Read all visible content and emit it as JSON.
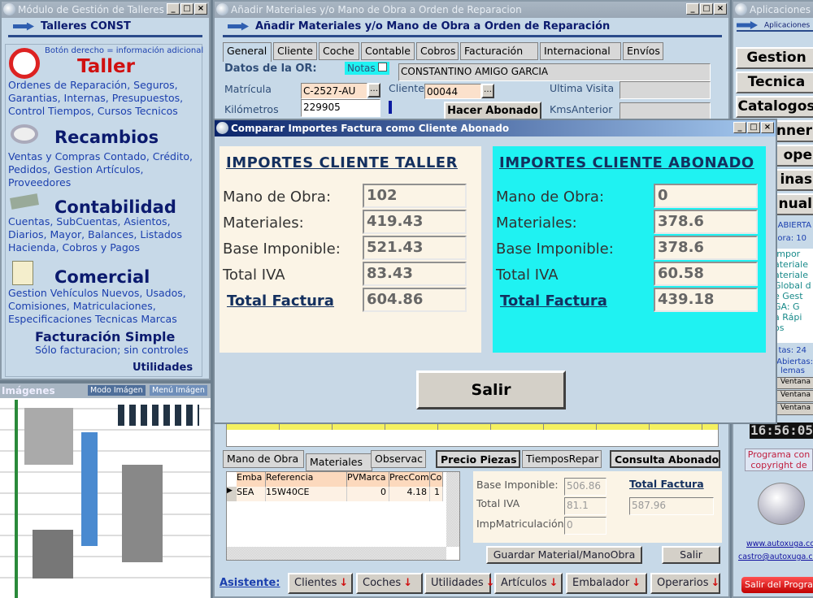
{
  "left_window": {
    "title": "Módulo de Gestión de Talleres",
    "header": "Talleres CONST",
    "hint": "Botón derecho = información adicional",
    "modules": [
      {
        "title": "Taller",
        "desc": "Ordenes de Reparación, Seguros, Garantias, Internas, Presupuestos, Control Tiempos, Cursos Tecnicos",
        "icon": "clock-icon"
      },
      {
        "title": "Recambios",
        "desc": "Ventas y Compras Contado, Crédito, Pedidos,  Gestion Artículos, Proveedores",
        "icon": "parts-icon"
      },
      {
        "title": "Contabilidad",
        "desc": "Cuentas, SubCuentas, Asientos, Diarios, Mayor, Balances, Listados Hacienda, Cobros y Pagos",
        "icon": "money-icon"
      },
      {
        "title": "Comercial",
        "desc": "Gestion Vehículos Nuevos, Usados, Comisiones, Matriculaciones, Especificaciones Tecnicas Marcas",
        "icon": "document-icon"
      }
    ],
    "simple_title": "Facturación Simple",
    "simple_desc": "Sólo facturacion; sin controles",
    "utilities": "Utilidades"
  },
  "images_panel": {
    "title": "Imágenes",
    "mode_button": "Modo Imágen",
    "menu_button": "Menú Imágen"
  },
  "main_window": {
    "title": "Añadir Materiales y/o Mano de Obra a Orden de Reparacion",
    "header": "Añadir Materiales y/o Mano de Obra a Orden de Reparación",
    "tabs": [
      "General",
      "Cliente",
      "Coche",
      "Contable",
      "Cobros",
      "Facturación",
      "Internacional",
      "Envíos"
    ],
    "datos_label": "Datos de la OR:",
    "notas_label": "Notas",
    "client_name": "CONSTANTINO AMIGO GARCIA",
    "matricula_label": "Matrícula",
    "matricula": "C-2527-AU",
    "cliente_label": "Cliente",
    "cliente": "00044",
    "ultima_visita_label": "Ultima Visita",
    "kms_label": "Kilómetros",
    "kms": "229905",
    "kms_anterior_label": "KmsAnterior",
    "hacer_abonado": "Hacer Abonado",
    "lower_tabs": [
      "Mano de Obra",
      "Materiales",
      "Observac",
      "Precio Piezas",
      "TiemposRepar",
      "Consulta Abonado"
    ],
    "grid_columns": [
      "Emba",
      "Referencia",
      "PVMarca",
      "PrecComp",
      "Co"
    ],
    "grid_rows": [
      [
        "SEA",
        "15W40CE",
        "0",
        "4.18",
        "1"
      ]
    ],
    "base_label": "Base Imponible:",
    "base": "506.86",
    "iva_label": "Total IVA",
    "iva": "81.1",
    "imp_label": "ImpMatriculación",
    "imp": "0",
    "total_label": "Total Factura",
    "total": "587.96",
    "save_button": "Guardar Material/ManoObra",
    "exit_button": "Salir",
    "assistant_label": "Asistente:",
    "assistant_buttons": [
      "Clientes",
      "Coches",
      "Utilidades",
      "Artículos",
      "Embalador",
      "Operarios"
    ]
  },
  "dialog": {
    "title": "Comparar Importes Factura como Cliente Abonado",
    "taller": {
      "heading": "IMPORTES CLIENTE TALLER",
      "rows": [
        {
          "label": "Mano de Obra:",
          "value": "102"
        },
        {
          "label": "Materiales:",
          "value": "419.43"
        },
        {
          "label": "Base Imponible:",
          "value": "521.43"
        },
        {
          "label": "Total IVA",
          "value": "83.43"
        },
        {
          "label": "Total Factura",
          "value": "604.86"
        }
      ]
    },
    "abonado": {
      "heading": "IMPORTES CLIENTE ABONADO",
      "rows": [
        {
          "label": "Mano de Obra:",
          "value": "0"
        },
        {
          "label": "Materiales:",
          "value": "378.6"
        },
        {
          "label": "Base Imponible:",
          "value": "378.6"
        },
        {
          "label": "Total IVA",
          "value": "60.58"
        },
        {
          "label": "Total Factura",
          "value": "439.18"
        }
      ]
    },
    "exit_button": "Salir"
  },
  "right_window": {
    "title": "Aplicaciones",
    "header": "Aplicaciones",
    "buttons": [
      "Gestion",
      "Tecnica",
      "Catalogos",
      "nner",
      "ope",
      "inas",
      "nual"
    ],
    "status1": "ABIERTA",
    "status2": "ora: 10",
    "list": [
      "Impor",
      "ateriale",
      "ateriale",
      "Global d",
      "e Gest",
      "GA:  G",
      "a Rápi",
      "os"
    ],
    "counts": "tas: 24",
    "open": "as Abiertas:",
    "problems": "lemas",
    "window_buttons": [
      "Ventana",
      "Ventana",
      "Ventana"
    ],
    "clock": "16:56:05",
    "copyright": "Programa con copyright de",
    "web": "www.autoxuga.com",
    "email": "castro@autoxuga.com",
    "exit": "Salir del Programa"
  },
  "colors": {
    "accent_cyan": "#1ff2f2",
    "cream": "#fbf4e6",
    "title_blue": "#0b1a6e",
    "red": "#d01010"
  }
}
